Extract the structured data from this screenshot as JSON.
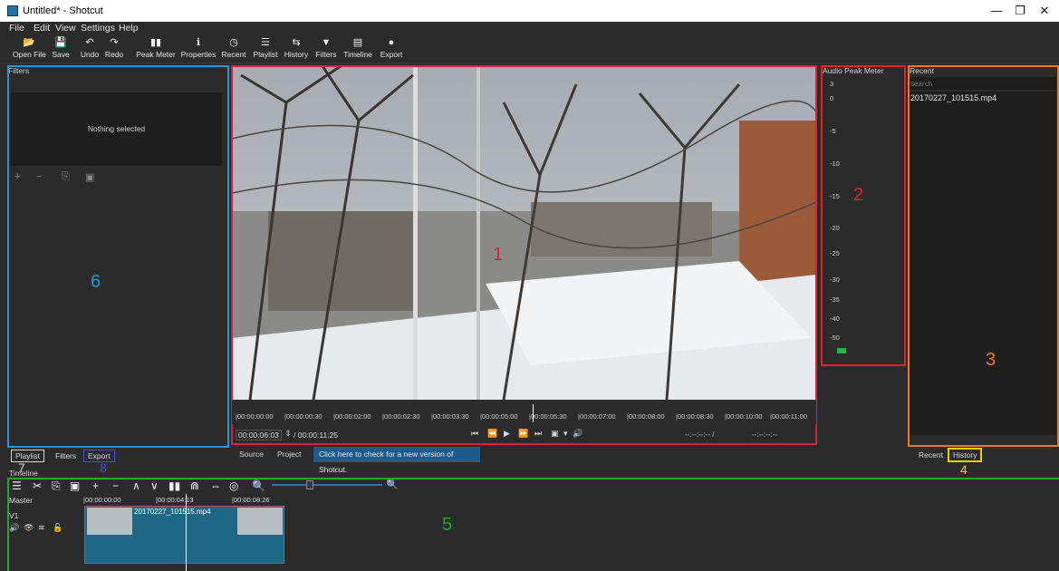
{
  "window": {
    "title": "Untitled* - Shotcut",
    "minimize": "—",
    "maximize": "❐",
    "close": "✕"
  },
  "menu": [
    "File",
    "Edit",
    "View",
    "Settings",
    "Help"
  ],
  "toolbar": [
    {
      "icon": "📂",
      "label": "Open File",
      "name": "open-file"
    },
    {
      "icon": "💾",
      "label": "Save",
      "name": "save"
    },
    {
      "icon": "↶",
      "label": "Undo",
      "name": "undo"
    },
    {
      "icon": "↷",
      "label": "Redo",
      "name": "redo"
    },
    {
      "icon": "▮▮",
      "label": "Peak Meter",
      "name": "peak-meter"
    },
    {
      "icon": "ℹ",
      "label": "Properties",
      "name": "properties"
    },
    {
      "icon": "◷",
      "label": "Recent",
      "name": "recent"
    },
    {
      "icon": "☰",
      "label": "Playlist",
      "name": "playlist"
    },
    {
      "icon": "⇆",
      "label": "History",
      "name": "history"
    },
    {
      "icon": "▼",
      "label": "Filters",
      "name": "filters"
    },
    {
      "icon": "▤",
      "label": "Timeline",
      "name": "timeline"
    },
    {
      "icon": "●",
      "label": "Export",
      "name": "export"
    }
  ],
  "filters_panel": {
    "title": "Filters",
    "nothing_selected": "Nothing selected",
    "icons": [
      "+",
      "−",
      "⎘",
      "▣"
    ]
  },
  "left_tabs": {
    "playlist": "Playlist",
    "filters": "Filters",
    "export": "Export"
  },
  "viewer": {
    "timecodes": [
      "|00:00:00:00",
      "|00:00:00:30",
      "|00:00:02:00",
      "|00:00:02:30",
      "|00:00:03:30",
      "|00:00:05:00",
      "|00:00:05:30",
      "|00:00:07:00",
      "|00:00:08:00",
      "|00:00:08:30",
      "|00:00:10:00",
      "|00:00:11:00"
    ],
    "position": "00:00:06:03",
    "duration": "/ 00:00:11:25",
    "in_out_left": "--:--:--:-- /",
    "in_out_right": "--:--:--:--",
    "transport": [
      "⏮",
      "⏪",
      "▶",
      "⏩",
      "⏭",
      "▣",
      "▾",
      "🔊"
    ]
  },
  "viewer_tabs": {
    "source": "Source",
    "project": "Project",
    "update_notice": "Click here to check for a new version of Shotcut."
  },
  "audio_meter": {
    "title": "Audio Peak Meter",
    "levels": [
      "3",
      "0",
      "-5",
      "-10",
      "-15",
      "-20",
      "-25",
      "-30",
      "-35",
      "-40",
      "-50"
    ]
  },
  "recent_panel": {
    "title": "Recent",
    "search_placeholder": "search",
    "items": [
      "20170227_101515.mp4"
    ]
  },
  "right_tabs": {
    "recent": "Recent",
    "history": "History"
  },
  "timeline": {
    "title": "Timeline",
    "tools": [
      "☰",
      "✂",
      "⎘",
      "▣",
      "+",
      "−",
      "∧",
      "∨",
      "▮▮",
      "⋒",
      "⇔",
      "◎",
      "🔍"
    ],
    "master": "Master",
    "track": "V1",
    "track_icons": [
      "🔊",
      "👁",
      "≋",
      "🔓"
    ],
    "ruler": [
      "|00:00:00:00",
      "|00:00:04:13",
      "|00:00:08:26"
    ],
    "clip_name": "20170227_101515.mp4"
  },
  "annotations": [
    {
      "number": "1",
      "color": "#d0253a"
    },
    {
      "number": "2",
      "color": "#e02424"
    },
    {
      "number": "3",
      "color": "#f07a1a"
    },
    {
      "number": "4",
      "color": "#e8d000"
    },
    {
      "number": "5",
      "color": "#2aa52a"
    },
    {
      "number": "6",
      "color": "#2394d8"
    },
    {
      "number": "7",
      "color": "#d8d8d8"
    },
    {
      "number": "8",
      "color": "#4c4ce0"
    }
  ]
}
